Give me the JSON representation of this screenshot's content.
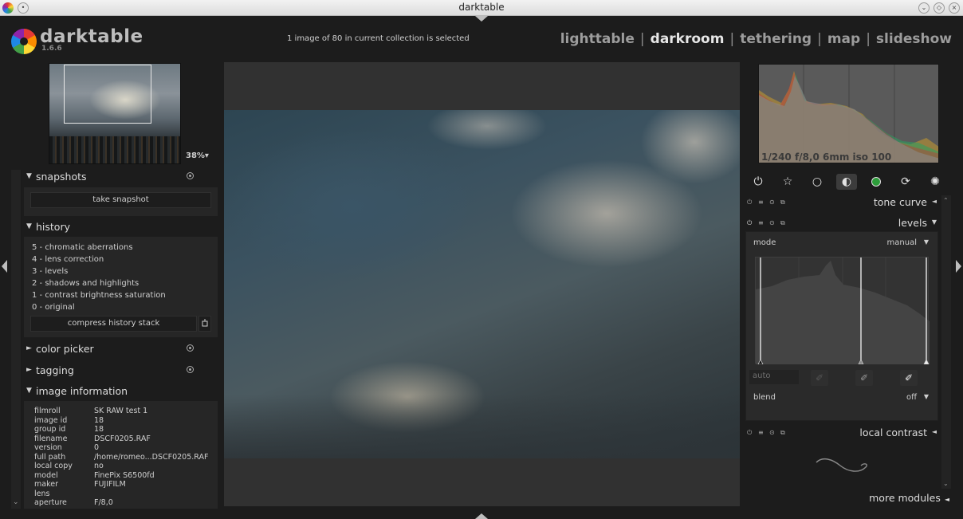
{
  "window": {
    "title": "darktable"
  },
  "header": {
    "app_name": "darktable",
    "version": "1.6.6",
    "selection_info": "1 image of 80 in current collection is selected",
    "views": [
      {
        "label": "lighttable"
      },
      {
        "label": "darkroom",
        "active": true
      },
      {
        "label": "tethering"
      },
      {
        "label": "map"
      },
      {
        "label": "slideshow"
      }
    ],
    "separator": "|"
  },
  "navigator": {
    "zoom": "38%▾"
  },
  "left_panel": {
    "snapshots": {
      "title": "snapshots",
      "take_snapshot": "take snapshot"
    },
    "history": {
      "title": "history",
      "items": [
        "5 - chromatic aberrations",
        "4 - lens correction",
        "3 - levels",
        "2 - shadows and highlights",
        "1 - contrast brightness saturation",
        "0 - original"
      ],
      "compress_button": "compress history stack"
    },
    "color_picker": {
      "title": "color picker"
    },
    "tagging": {
      "title": "tagging"
    },
    "image_information": {
      "title": "image information",
      "rows": [
        {
          "label": "filmroll",
          "value": "SK RAW test 1"
        },
        {
          "label": "image id",
          "value": "18"
        },
        {
          "label": "group id",
          "value": "18"
        },
        {
          "label": "filename",
          "value": "DSCF0205.RAF"
        },
        {
          "label": "version",
          "value": "0"
        },
        {
          "label": "full path",
          "value": "/home/romeo...DSCF0205.RAF"
        },
        {
          "label": "local copy",
          "value": "no"
        },
        {
          "label": "model",
          "value": "FinePix S6500fd"
        },
        {
          "label": "maker",
          "value": "FUJIFILM"
        },
        {
          "label": "lens",
          "value": ""
        },
        {
          "label": "aperture",
          "value": "F/8,0"
        }
      ]
    }
  },
  "right_panel": {
    "exif_summary": "1/240 f/8,0 6mm iso 100",
    "module_groups": [
      {
        "icon": "power-icon"
      },
      {
        "icon": "star-icon"
      },
      {
        "icon": "circle-outline-icon"
      },
      {
        "icon": "half-circle-icon",
        "active": true
      },
      {
        "icon": "color-circle-icon"
      },
      {
        "icon": "correct-icon"
      },
      {
        "icon": "effect-icon"
      }
    ],
    "modules": {
      "tone_curve": {
        "name": "tone curve"
      },
      "levels": {
        "name": "levels",
        "mode_label": "mode",
        "mode_value": "manual",
        "auto_placeholder": "auto",
        "blend_label": "blend",
        "blend_value": "off"
      },
      "local_contrast": {
        "name": "local contrast"
      }
    },
    "more_modules": "more modules"
  },
  "colors": {
    "background": "#1c1c1c",
    "panel": "#262626",
    "text": "#dcdcdc",
    "active_view": "#e6e6e6"
  }
}
